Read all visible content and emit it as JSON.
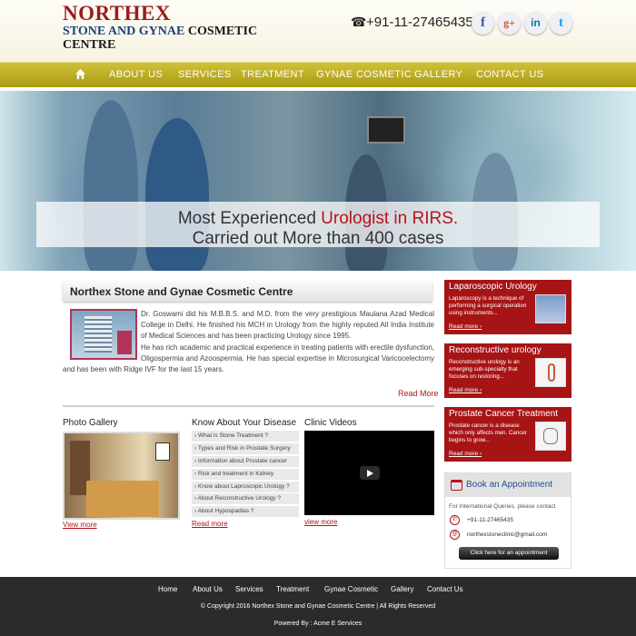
{
  "brand": {
    "name": "NORTHEX",
    "subtitle_part1": "STONE AND GYNAE",
    "subtitle_part2": " COSMETIC CENTRE"
  },
  "header": {
    "phone": "+91-11-27465435",
    "social": [
      {
        "name": "facebook",
        "glyph": "f",
        "color": "#3b5998"
      },
      {
        "name": "google-plus",
        "glyph": "g+",
        "color": "#dd4b39"
      },
      {
        "name": "linkedin",
        "glyph": "in",
        "color": "#0e76a8"
      },
      {
        "name": "twitter",
        "glyph": "t",
        "color": "#1da1f2"
      }
    ]
  },
  "nav": {
    "items": [
      "ABOUT US",
      "SERVICES",
      "TREATMENT",
      "GYNAE COSMETIC",
      "GALLERY",
      "CONTACT US"
    ]
  },
  "banner": {
    "line1_a": "Most Experienced ",
    "line1_b": "Urologist  in RIRS.",
    "line2": "Carried out More than 400 cases"
  },
  "about": {
    "title": "Northex Stone and Gynae Cosmetic Centre",
    "para1": "Dr. Goswami did his M.B.B.S. and M.D. from the very prestigious Maulana Azad Medical College in Delhi. He finished his MCH in Urology from the highly reputed All India Institute of Medical Sciences and has been practicing Urology since 1995.",
    "para2": "He has rich academic and practical experience in treating patients with erectile dysfunction, Oligospermia and Azoospermia. He has special expertise in Microsurgical Varicocelectomy and has been with Ridge IVF for the last 15 years.",
    "read_more": "Read More"
  },
  "gallery": {
    "title": "Photo Gallery",
    "view_more": "View more"
  },
  "disease": {
    "title": "Know About Your Disease",
    "items": [
      "What is Stone Treatment ?",
      "Types and Risk in Prostate Surgery",
      "Information about Prostate cancer",
      "Risk and treatment in Kidney",
      "Know about Laproscopic Urology ?",
      "About Reconstructive Urology ?",
      "About Hypospadias ?"
    ],
    "read_more": "Read more"
  },
  "videos": {
    "title": "Clinic Videos",
    "view_more": "view more"
  },
  "sidebar": {
    "boxes": [
      {
        "title": "Laparoscopic Urology",
        "desc": "Laparoscopy is a technique of performing a surgical operation using instruments...",
        "read": "Read more"
      },
      {
        "title": "Reconstructive urology",
        "desc": "Reconstructive urology is an emerging sub-specialty that focuses on restoring...",
        "read": "Read more"
      },
      {
        "title": "Prostate Cancer Treatment",
        "desc": "Prostate cancer is a disease which only affects men. Cancer begins to grow...",
        "read": "Read more"
      }
    ]
  },
  "appointment": {
    "title": "Book an Appointment",
    "intl": "For International Queries, please contact",
    "phone": "+91-11-27465435",
    "email": "northexstoneclinic@gmail.com",
    "button": "Click here for an appointment"
  },
  "footer": {
    "links": [
      "Home",
      "About Us",
      "Services",
      "Treatment",
      "Gynae Cosmetic",
      "Gallery",
      "Contact Us"
    ],
    "copyright": "© Copyright 2016 Northex Stone and Gynae Cosmetic Centre | All Rights Reserved",
    "powered": "Powered By : Acme E Services"
  }
}
